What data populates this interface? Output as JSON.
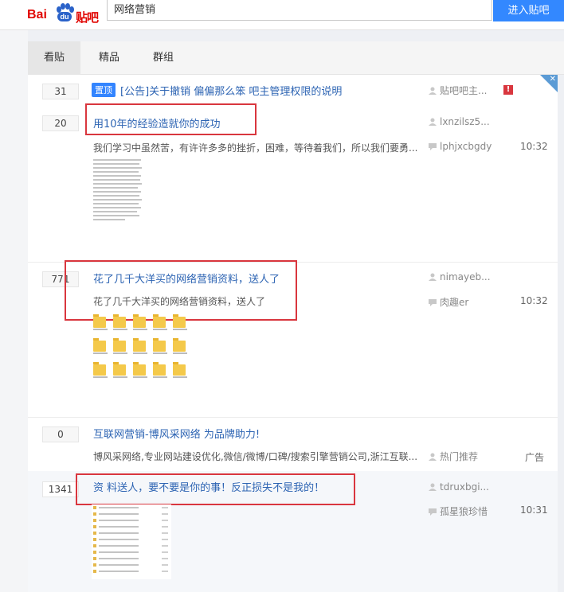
{
  "header": {
    "logo_bai": "Bai",
    "logo_du": "du",
    "logo_tieba": "贴吧",
    "search_value": "网络营销",
    "enter_button": "进入贴吧"
  },
  "tabs": [
    {
      "label": "看贴",
      "active": true
    },
    {
      "label": "精品",
      "active": false
    },
    {
      "label": "群组",
      "active": false
    }
  ],
  "threads": [
    {
      "reply_count": "31",
      "tag": "置顶",
      "title": "[公告]关于撤销 偏偏那么笨 吧主管理权限的说明",
      "author": "贴吧吧主..."
    },
    {
      "reply_count": "20",
      "title": "用10年的经验造就你的成功",
      "abstract": "我们学习中虽然苦，有许许多多的挫折，困难，等待着我们，所以我们要勇...",
      "author": "lxnzilsz5...",
      "last_replier": "lphjxcbgdy",
      "time": "10:32"
    },
    {
      "reply_count": "771",
      "title": "花了几千大洋买的网络营销资料，送人了",
      "abstract": "花了几千大洋买的网络营销资料，送人了",
      "author": "nimayeb...",
      "last_replier": "肉趣er",
      "time": "10:32"
    },
    {
      "reply_count": "0",
      "title": "互联网营销-博风采网络 为品牌助力!",
      "abstract": "博风采网络,专业网站建设优化,微信/微博/口碑/搜索引擎营销公司,浙江互联...",
      "author": "热门推荐",
      "ad_label": "广告"
    },
    {
      "reply_count": "1341",
      "title": "资 料送人，要不要是你的事！反正损失不是我的！",
      "author": "tdruxbgi...",
      "last_replier": "孤星狼珍惜",
      "time": "10:31"
    }
  ],
  "colors": {
    "accent": "#3388ff",
    "link": "#2d64b3",
    "highlight_box": "#d9363e"
  }
}
